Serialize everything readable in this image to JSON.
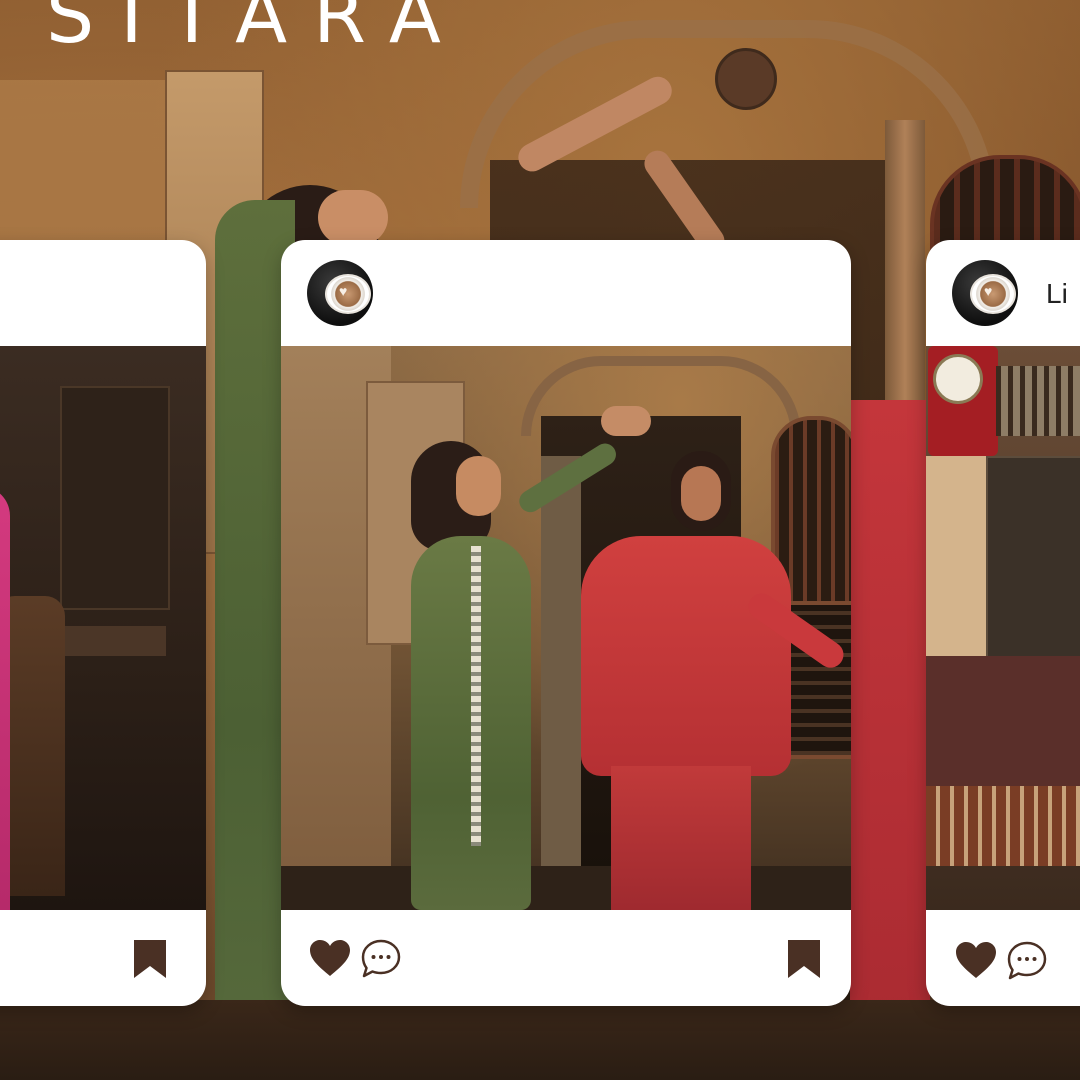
{
  "brand": {
    "name": "SITARA"
  },
  "colors": {
    "accent": "#4a3024",
    "card": "#ffffff"
  },
  "posts": {
    "left": {
      "actions": [
        "bookmark-icon"
      ]
    },
    "center": {
      "avatar": "coffee-latte-art-avatar",
      "username": "",
      "actions": [
        "heart-icon",
        "comment-icon",
        "bookmark-icon"
      ]
    },
    "right": {
      "avatar": "coffee-latte-art-avatar",
      "username": "Li",
      "actions": [
        "heart-icon",
        "comment-icon"
      ]
    }
  }
}
